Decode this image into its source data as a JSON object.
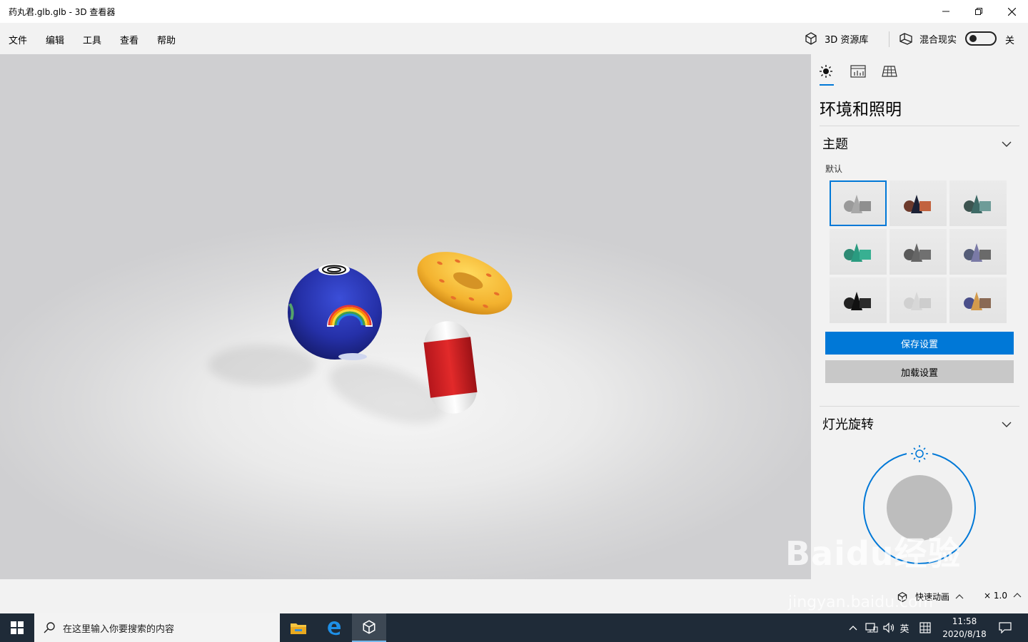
{
  "window": {
    "title": "药丸君.glb.glb - 3D 查看器",
    "minimize_icon": "minimize-icon",
    "maximize_icon": "restore-icon",
    "close_icon": "close-icon"
  },
  "menubar": {
    "items": [
      "文件",
      "编辑",
      "工具",
      "查看",
      "帮助"
    ],
    "library_label": "3D 资源库",
    "mixed_reality_label": "混合现实",
    "toggle_state": "关"
  },
  "panel": {
    "title": "环境和照明",
    "theme_section": "主题",
    "theme_selected": "默认",
    "save_button": "保存设置",
    "load_button": "加载设置",
    "light_section": "灯光旋转"
  },
  "statusbar": {
    "animation_label": "快速动画",
    "speed": "× 1.0"
  },
  "taskbar": {
    "search_placeholder": "在这里输入你要搜索的内容",
    "ime": "英",
    "time": "11:58",
    "date": "2020/8/18"
  },
  "watermark": {
    "brand": "Baidu经验",
    "url": "jingyan.baidu.com"
  },
  "colors": {
    "accent": "#0078d7",
    "taskbar": "#1f2b38",
    "panel_bg": "#f2f2f2"
  }
}
